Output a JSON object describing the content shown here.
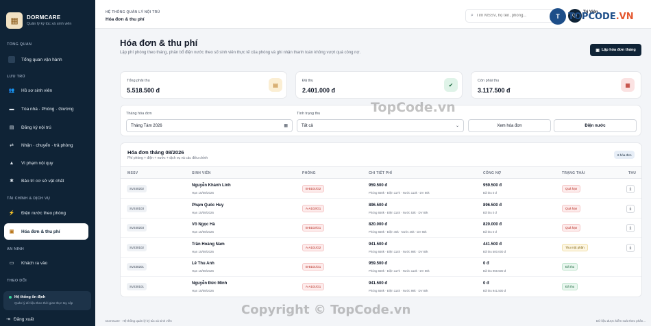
{
  "brand": {
    "name": "DORMCARE",
    "subtitle": "Quản lý ký túc xá sinh viên",
    "logo_icon": "building-icon"
  },
  "sidebar": {
    "sections": [
      {
        "label": "TỔNG QUAN",
        "items": [
          {
            "label": "Tổng quan vận hành",
            "icon": "dashboard-icon"
          }
        ]
      },
      {
        "label": "LƯU TRÚ",
        "items": [
          {
            "label": "Hồ sơ sinh viên",
            "icon": "users-icon"
          },
          {
            "label": "Tòa nhà · Phòng · Giường",
            "icon": "bed-icon"
          },
          {
            "label": "Đăng ký nội trú",
            "icon": "form-icon"
          },
          {
            "label": "Nhận · chuyển · trả phòng",
            "icon": "swap-icon"
          },
          {
            "label": "Vi phạm nội quy",
            "icon": "warning-icon"
          },
          {
            "label": "Bảo trì cơ sở vật chất",
            "icon": "wrench-icon"
          }
        ]
      },
      {
        "label": "TÀI CHÍNH & DỊCH VỤ",
        "items": [
          {
            "label": "Điện nước theo phòng",
            "icon": "bolt-icon"
          },
          {
            "label": "Hóa đơn & thu phí",
            "icon": "receipt-icon",
            "active": true
          }
        ]
      },
      {
        "label": "AN NINH",
        "items": [
          {
            "label": "Khách ra vào",
            "icon": "id-card-icon"
          }
        ]
      },
      {
        "label": "THEO DÕI",
        "items": []
      }
    ],
    "status": {
      "title": "Hệ thống ổn định",
      "subtitle": "Quản lý dữ liệu theo thời gian thực tay cập"
    },
    "logout": "Đăng xuất"
  },
  "topbar": {
    "breadcrumb": "HỆ THỐNG QUẢN LÝ NỘI TRÚ",
    "title": "Hóa đơn & thu phí",
    "search_placeholder": "Tìm MSSV, họ tên, phòng...",
    "user": "Trị Viên",
    "avatar": "QT"
  },
  "page": {
    "title": "Hóa đơn & thu phí",
    "lead": "Lập phí phòng theo tháng, phân bổ điện nước theo số sinh viên thực tế của phòng và ghi nhận thanh toán không vượt quá công nợ.",
    "create_button": "Lập hóa đơn tháng"
  },
  "stats": [
    {
      "label": "Tổng phải thu",
      "value": "5.518.500 đ",
      "icon": "wallet-icon",
      "color": "#fbeed3"
    },
    {
      "label": "Đã thu",
      "value": "2.401.000 đ",
      "icon": "check-icon",
      "color": "#dff3e8"
    },
    {
      "label": "Còn phải thu",
      "value": "3.117.500 đ",
      "icon": "calendar-icon",
      "color": "#fbe2e2"
    }
  ],
  "filters": {
    "month_label": "Tháng hóa đơn",
    "month_value": "Tháng Tám 2026",
    "status_label": "Tình trạng thu",
    "status_value": "Tất cả",
    "view_button": "Xem hóa đơn",
    "utility_button": "Điện nước"
  },
  "table": {
    "title": "Hóa đơn tháng 08/2026",
    "subtitle": "Phí phòng + điện + nước + dịch vụ và các điều chỉnh",
    "count": "6 hóa đơn",
    "headers": [
      "MSSV",
      "SINH VIÊN",
      "PHÒNG",
      "CHI TIẾT PHÍ",
      "CÔNG NỢ",
      "TRẠNG THÁI",
      "THU"
    ],
    "rows": [
      {
        "mssv": "SV240202",
        "name": "Nguyễn Khánh Linh",
        "due": "Hạn 15/08/2026",
        "room": "B-B101/G2",
        "amount": "959.500 đ",
        "detail": "Phòng 650k · Điện 117k · Nước 113k · DV 80k",
        "debt": "959.500 đ",
        "paid": "Đã thu 0 đ",
        "status": "Quá hạn",
        "status_type": "over"
      },
      {
        "mssv": "SV240103",
        "name": "Phạm Quốc Huy",
        "due": "Hạn 15/08/2026",
        "room": "A-A102/G1",
        "amount": "896.500 đ",
        "detail": "Phòng 650k · Điện 114k · Nước 53k · DV 80k",
        "debt": "896.500 đ",
        "paid": "Đã thu 0 đ",
        "status": "Quá hạn",
        "status_type": "over"
      },
      {
        "mssv": "SV240203",
        "name": "Võ Ngọc Hà",
        "due": "Hạn 15/08/2026",
        "room": "B-B102/G1",
        "amount": "820.000 đ",
        "detail": "Phòng 650k · Điện 45k · Nước 45k · DV 80k",
        "debt": "820.000 đ",
        "paid": "Đã thu 0 đ",
        "status": "Quá hạn",
        "status_type": "over"
      },
      {
        "mssv": "SV230102",
        "name": "Trần Hoàng Nam",
        "due": "Hạn 15/08/2026",
        "room": "A-A101/G2",
        "amount": "941.500 đ",
        "detail": "Phòng 650k · Điện 114k · Nước 98k · DV 80k",
        "debt": "441.500 đ",
        "paid": "Đã thu 500.000 đ",
        "status": "Thu một phần",
        "status_type": "part"
      },
      {
        "mssv": "SV230201",
        "name": "Lê Thu Anh",
        "due": "Hạn 15/08/2026",
        "room": "B-B101/G1",
        "amount": "959.500 đ",
        "detail": "Phòng 650k · Điện 117k · Nước 113k · DV 80k",
        "debt": "0 đ",
        "paid": "Đã thu 959.500 đ",
        "status": "Đã thu",
        "status_type": "paid"
      },
      {
        "mssv": "SV230101",
        "name": "Nguyễn Đức Minh",
        "due": "Hạn 15/08/2026",
        "room": "A-A101/G1",
        "amount": "941.500 đ",
        "detail": "Phòng 650k · Điện 114k · Nước 98k · DV 80k",
        "debt": "0 đ",
        "paid": "Đã thu 941.500 đ",
        "status": "Đã thu",
        "status_type": "paid"
      }
    ]
  },
  "footer": {
    "left": "DormCare · Hệ thống quản lý ký túc xá sinh viên",
    "right": "Dữ liệu được kiểm soát theo phân..."
  },
  "watermarks": {
    "logo_prefix": "TOPCODE",
    "logo_suffix": ".VN",
    "center": "TopCode.vn",
    "copyright": "Copyright © TopCode.vn"
  }
}
